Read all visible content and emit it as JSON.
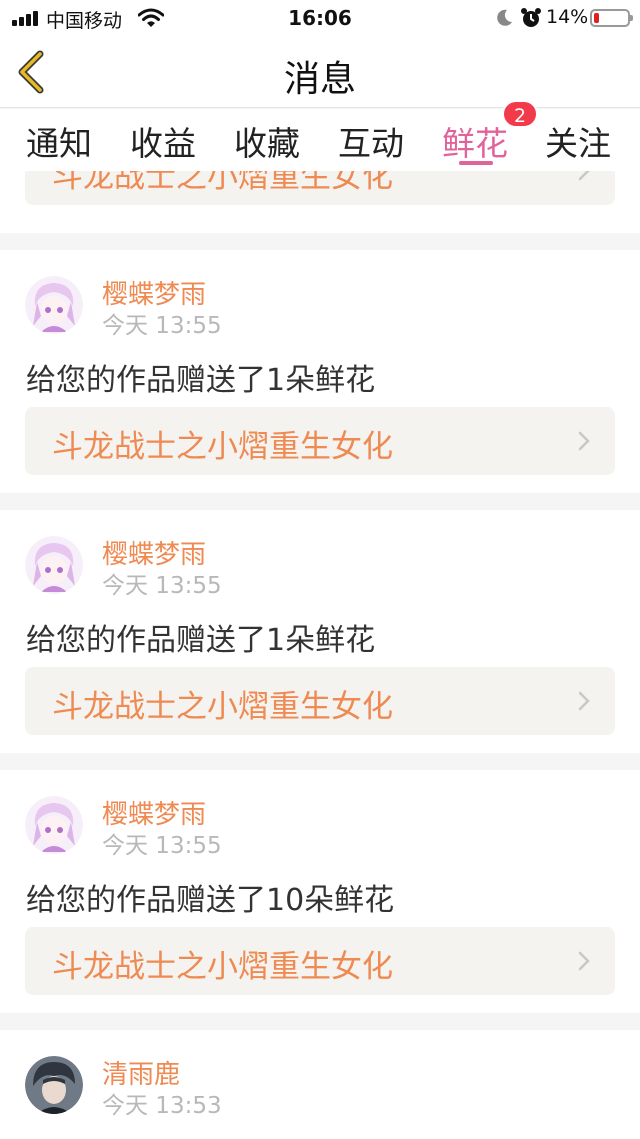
{
  "status_bar": {
    "carrier": "中国移动",
    "time": "16:06",
    "battery_percent": "14%"
  },
  "nav": {
    "title": "消息",
    "back_icon": "chevron-left-icon"
  },
  "tabs": [
    {
      "label": "通知",
      "active": false
    },
    {
      "label": "收益",
      "active": false
    },
    {
      "label": "收藏",
      "active": false
    },
    {
      "label": "互动",
      "active": false
    },
    {
      "label": "鲜花",
      "active": true
    },
    {
      "label": "关注",
      "active": false
    }
  ],
  "tab_badge": "2",
  "feed": {
    "top_partial": {
      "work_title": "斗龙战士之小熠重生女化"
    },
    "items": [
      {
        "username": "樱蝶梦雨",
        "time": "今天 13:55",
        "message": "给您的作品赠送了1朵鲜花",
        "work_title": "斗龙战士之小熠重生女化"
      },
      {
        "username": "樱蝶梦雨",
        "time": "今天 13:55",
        "message": "给您的作品赠送了1朵鲜花",
        "work_title": "斗龙战士之小熠重生女化"
      },
      {
        "username": "樱蝶梦雨",
        "time": "今天 13:55",
        "message": "给您的作品赠送了10朵鲜花",
        "work_title": "斗龙战士之小熠重生女化"
      },
      {
        "username": "清雨鹿",
        "time": "今天 13:53"
      }
    ]
  },
  "colors": {
    "accent_pink": "#e0639a",
    "username_orange": "#ee8a52",
    "badge_red": "#f23a4a",
    "back_arrow_yellow": "#e8b923"
  }
}
